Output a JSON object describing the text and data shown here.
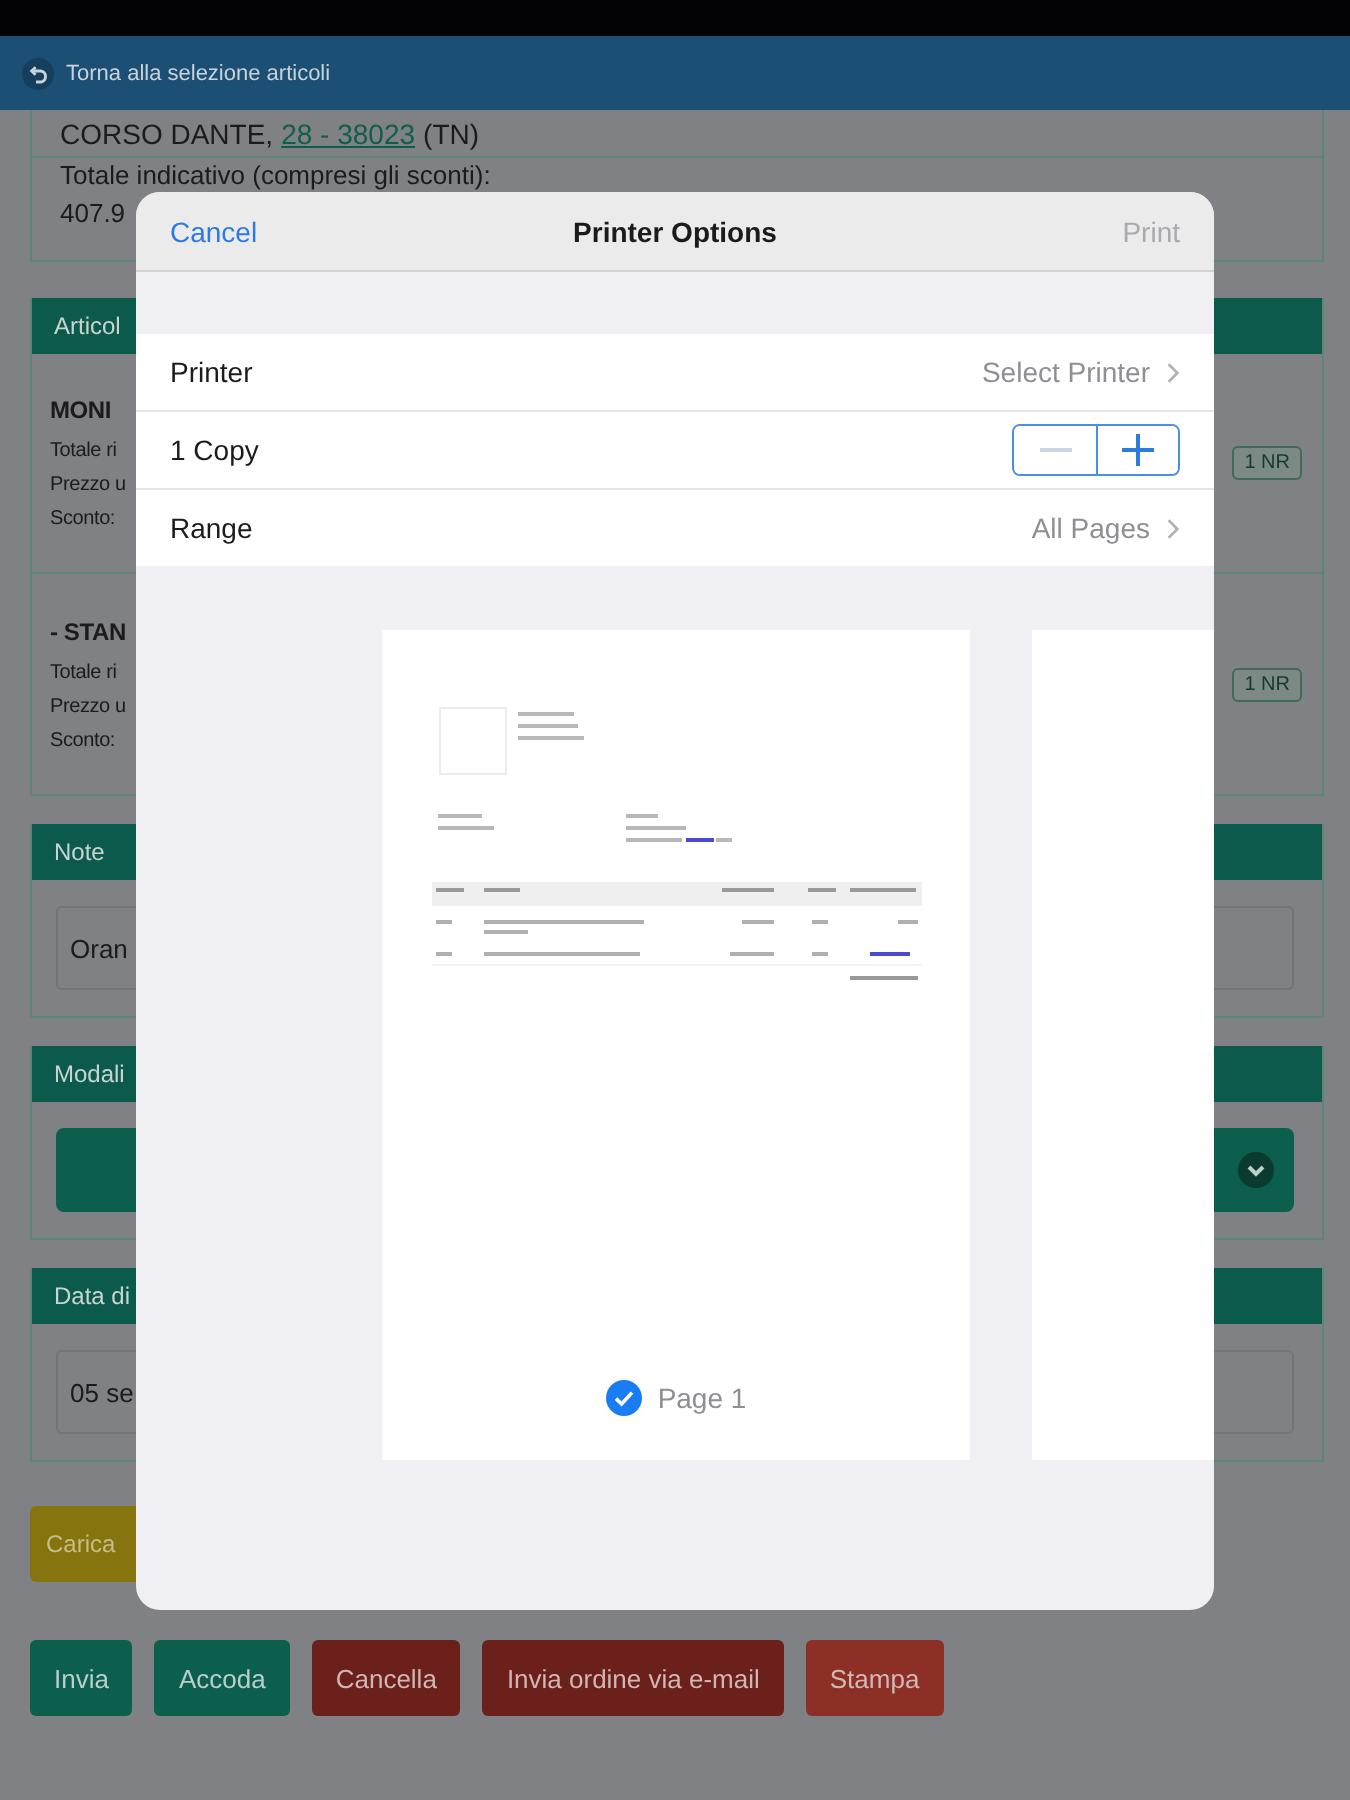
{
  "header": {
    "back_label": "Torna alla selezione articoli"
  },
  "address": {
    "street": "CORSO DANTE,",
    "link": "28 - 38023",
    "suffix": "(TN)"
  },
  "total": {
    "label": "Totale indicativo (compresi gli sconti):",
    "value": "407.9"
  },
  "articles": {
    "title": "Articol",
    "items": [
      {
        "name": "MONI",
        "lines": [
          "Totale ri",
          "Prezzo u",
          "Sconto:"
        ],
        "badge": "1 NR"
      },
      {
        "name": "- STAN",
        "lines": [
          "Totale ri",
          "Prezzo u",
          "Sconto:"
        ],
        "badge": "1 NR"
      }
    ]
  },
  "note": {
    "title": "Note",
    "value": "Oran"
  },
  "payment": {
    "title": "Modali"
  },
  "date": {
    "title": "Data di",
    "value": "05 se"
  },
  "load_button": "Carica",
  "actions": [
    {
      "label": "Invia",
      "kind": "primary"
    },
    {
      "label": "Accoda",
      "kind": "primary"
    },
    {
      "label": "Cancella",
      "kind": "danger"
    },
    {
      "label": "Invia ordine via e-mail",
      "kind": "danger"
    },
    {
      "label": "Stampa",
      "kind": "warning"
    }
  ],
  "print_dialog": {
    "cancel": "Cancel",
    "title": "Printer Options",
    "print": "Print",
    "print_disabled": true,
    "rows": [
      {
        "kind": "link",
        "label": "Printer",
        "value": "Select Printer"
      },
      {
        "kind": "stepper",
        "label": "1 Copy",
        "minus_disabled": true
      },
      {
        "kind": "link",
        "label": "Range",
        "value": "All Pages"
      }
    ],
    "pages": [
      {
        "label": "Page 1",
        "selected": true
      }
    ]
  }
}
